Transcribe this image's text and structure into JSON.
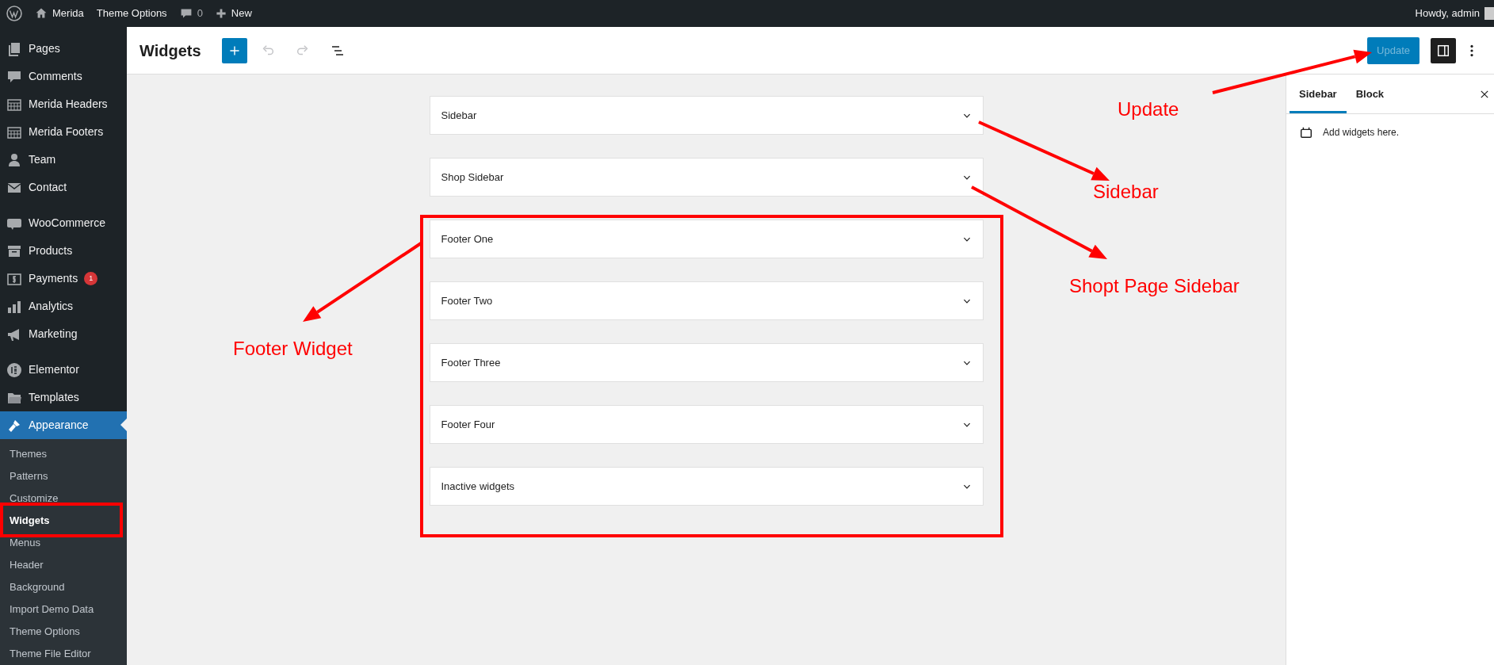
{
  "admin_bar": {
    "site": "Merida",
    "theme_options": "Theme Options",
    "comments_count": "0",
    "new": "New",
    "greeting": "Howdy, admin"
  },
  "sidebar": {
    "groups": [
      [
        {
          "label": "Pages",
          "selected": false
        },
        {
          "label": "Comments",
          "selected": false
        },
        {
          "label": "Merida Headers",
          "selected": false
        },
        {
          "label": "Merida Footers",
          "selected": false
        },
        {
          "label": "Team",
          "selected": false
        },
        {
          "label": "Contact",
          "selected": false
        }
      ],
      [
        {
          "label": "WooCommerce",
          "selected": false
        },
        {
          "label": "Products",
          "selected": false
        },
        {
          "label": "Payments",
          "selected": false,
          "badge": "1"
        },
        {
          "label": "Analytics",
          "selected": false
        },
        {
          "label": "Marketing",
          "selected": false
        }
      ],
      [
        {
          "label": "Elementor",
          "selected": false
        },
        {
          "label": "Templates",
          "selected": false
        },
        {
          "label": "Appearance",
          "selected": true,
          "children": [
            {
              "label": "Themes",
              "selected": false
            },
            {
              "label": "Patterns",
              "selected": false
            },
            {
              "label": "Customize",
              "selected": false
            },
            {
              "label": "Widgets",
              "selected": true
            },
            {
              "label": "Menus",
              "selected": false
            },
            {
              "label": "Header",
              "selected": false
            },
            {
              "label": "Background",
              "selected": false
            },
            {
              "label": "Import Demo Data",
              "selected": false
            },
            {
              "label": "Theme Options",
              "selected": false
            },
            {
              "label": "Theme File Editor",
              "selected": false
            }
          ]
        }
      ]
    ]
  },
  "header": {
    "title": "Widgets",
    "undo_disabled": true,
    "redo_disabled": true,
    "update": {
      "label": "Update",
      "disabled": true
    }
  },
  "widget_areas": [
    {
      "title": "Sidebar"
    },
    {
      "title": "Shop Sidebar"
    },
    {
      "title": "Footer One"
    },
    {
      "title": "Footer Two"
    },
    {
      "title": "Footer Three"
    },
    {
      "title": "Footer Four"
    },
    {
      "title": "Inactive widgets"
    }
  ],
  "settings_panel": {
    "tabs": [
      {
        "label": "Sidebar",
        "selected": true
      },
      {
        "label": "Block",
        "selected": false
      }
    ],
    "message": "Add widgets here."
  },
  "annotations": [
    {
      "text": "Update"
    },
    {
      "text": "Sidebar"
    },
    {
      "text": "Shopt Page Sidebar"
    },
    {
      "text": "Footer Widget"
    }
  ]
}
